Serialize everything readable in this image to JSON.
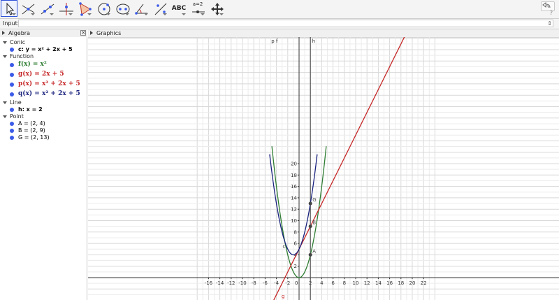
{
  "toolbar": {
    "tools": [
      {
        "name": "move-tool",
        "icon": "arrow-cursor-icon",
        "active": true
      },
      {
        "name": "point-tool",
        "icon": "point-on-lines-icon"
      },
      {
        "name": "line-tool",
        "icon": "line-through-points-icon"
      },
      {
        "name": "perpendicular-tool",
        "icon": "perpendicular-line-icon"
      },
      {
        "name": "polygon-tool",
        "icon": "triangle-icon"
      },
      {
        "name": "circle-tool",
        "icon": "circle-center-icon"
      },
      {
        "name": "conic-tool",
        "icon": "ellipse-icon"
      },
      {
        "name": "angle-tool",
        "icon": "angle-icon"
      },
      {
        "name": "reflect-tool",
        "icon": "reflect-icon"
      },
      {
        "name": "text-tool",
        "icon": "text-icon",
        "label": "ABC"
      },
      {
        "name": "slider-tool",
        "icon": "slider-icon",
        "label": "a=2"
      },
      {
        "name": "move-graphics-tool",
        "icon": "move-view-icon"
      }
    ],
    "help_label": "?"
  },
  "input_bar": {
    "label": "Input:",
    "value": "",
    "arrow": "⇕"
  },
  "algebra_panel": {
    "title": "Algebra",
    "categories": [
      {
        "name": "Conic",
        "items": [
          {
            "text": "c: y = x² + 2x + 5",
            "color": "#000000",
            "bold": true
          }
        ]
      },
      {
        "name": "Function",
        "items": [
          {
            "text": "f(x) = x²",
            "color": "#2e7d32"
          },
          {
            "text": "g(x) = 2x + 5",
            "color": "#c62828"
          },
          {
            "text": "p(x) = x² + 2x + 5",
            "color": "#c62828"
          },
          {
            "text": "q(x) = x² + 2x + 5",
            "color": "#1a237e"
          }
        ]
      },
      {
        "name": "Line",
        "items": [
          {
            "text": "h: x = 2",
            "color": "#000000",
            "bold": true
          }
        ]
      },
      {
        "name": "Point",
        "items": [
          {
            "text": "A = (2, 4)",
            "color": "#000000"
          },
          {
            "text": "B = (2, 9)",
            "color": "#000000"
          },
          {
            "text": "G = (2, 13)",
            "color": "#000000"
          }
        ]
      }
    ]
  },
  "graphics_panel": {
    "title": "Graphics",
    "axis": {
      "x_ticks": [
        "-16",
        "-14",
        "-12",
        "-10",
        "-8",
        "-6",
        "-4",
        "-2",
        "0",
        "2",
        "4",
        "6",
        "8",
        "10",
        "12",
        "14",
        "16",
        "18",
        "20",
        "22"
      ],
      "y_ticks": [
        "2",
        "4",
        "6",
        "8",
        "10",
        "12",
        "14",
        "16",
        "18",
        "20"
      ]
    },
    "labels": {
      "pf": "p f",
      "h": "h",
      "c": "c",
      "g": "g",
      "A": "A",
      "B": "B",
      "G": "G"
    },
    "colors": {
      "f": "#2e7d32",
      "g": "#c62828",
      "q": "#1a237e",
      "h": "#555555",
      "point": "#444444"
    }
  }
}
